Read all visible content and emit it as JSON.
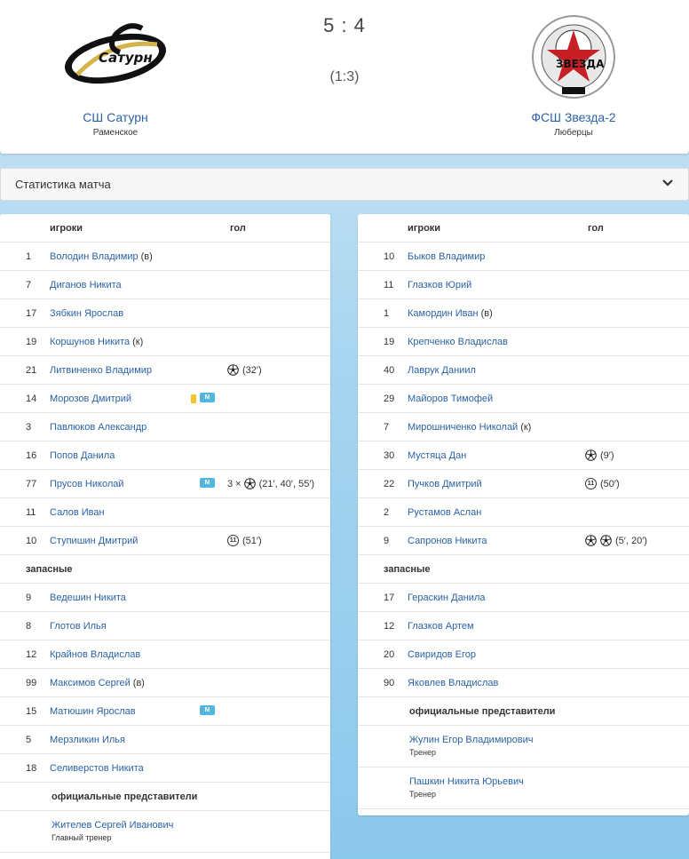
{
  "match": {
    "score": "5 : 4",
    "half_score": "(1:3)",
    "home": {
      "name": "СШ Сатурн",
      "city": "Раменское",
      "logo_text": "Сатурн"
    },
    "away": {
      "name": "ФСШ Звезда-2",
      "city": "Люберцы",
      "logo_text": "ЗВЕЗДА"
    }
  },
  "stats_bar": {
    "label": "Статистика матча"
  },
  "columns": {
    "players": "игроки",
    "goal": "гол"
  },
  "sections": {
    "subs": "запасные",
    "officials": "официальные представители"
  },
  "home_players": [
    {
      "num": "1",
      "name": "Володин Владимир",
      "tag": "(в)"
    },
    {
      "num": "7",
      "name": "Диганов Никита"
    },
    {
      "num": "17",
      "name": "Зябкин Ярослав"
    },
    {
      "num": "19",
      "name": "Коршунов Никита",
      "tag": "(к)"
    },
    {
      "num": "21",
      "name": "Литвиненко Владимир",
      "goal": "(32′)",
      "goal_type": "ball"
    },
    {
      "num": "14",
      "name": "Морозов Дмитрий",
      "yellow": true,
      "badge": "М"
    },
    {
      "num": "3",
      "name": "Павлюков Александр"
    },
    {
      "num": "16",
      "name": "Попов Данила"
    },
    {
      "num": "77",
      "name": "Прусов Николай",
      "badge": "М",
      "goal_prefix": "3 ×",
      "goal": "(21′, 40′, 55′)",
      "goal_type": "ball"
    },
    {
      "num": "11",
      "name": "Салов Иван"
    },
    {
      "num": "10",
      "name": "Ступишин Дмитрий",
      "goal": "(51′)",
      "goal_type": "pen"
    }
  ],
  "home_subs": [
    {
      "num": "9",
      "name": "Ведешин Никита"
    },
    {
      "num": "8",
      "name": "Глотов Илья"
    },
    {
      "num": "12",
      "name": "Крайнов Владислав"
    },
    {
      "num": "99",
      "name": "Максимов Сергей",
      "tag": "(в)"
    },
    {
      "num": "15",
      "name": "Матюшин Ярослав",
      "badge": "М"
    },
    {
      "num": "5",
      "name": "Мерзликин Илья"
    },
    {
      "num": "18",
      "name": "Селиверстов Никита"
    }
  ],
  "home_officials": [
    {
      "name": "Жителев Сергей Иванович",
      "role": "Главный тренер"
    }
  ],
  "away_players": [
    {
      "num": "10",
      "name": "Быков Владимир"
    },
    {
      "num": "11",
      "name": "Глазков Юрий"
    },
    {
      "num": "1",
      "name": "Камордин Иван",
      "tag": "(в)"
    },
    {
      "num": "19",
      "name": "Крепченко Владислав"
    },
    {
      "num": "40",
      "name": "Лаврук Даниил"
    },
    {
      "num": "29",
      "name": "Майоров Тимофей"
    },
    {
      "num": "7",
      "name": "Мирошниченко Николай",
      "tag": "(к)"
    },
    {
      "num": "30",
      "name": "Мустяца Дан",
      "goal": "(9′)",
      "goal_type": "ball"
    },
    {
      "num": "22",
      "name": "Пучков Дмитрий",
      "goal": "(50′)",
      "goal_type": "pen"
    },
    {
      "num": "2",
      "name": "Рустамов Аслан"
    },
    {
      "num": "9",
      "name": "Сапронов Никита",
      "goal": "(5′, 20′)",
      "goal_type": "ball2"
    }
  ],
  "away_subs": [
    {
      "num": "17",
      "name": "Гераскин Данила"
    },
    {
      "num": "12",
      "name": "Глазков Артем"
    },
    {
      "num": "20",
      "name": "Свиридов Егор"
    },
    {
      "num": "90",
      "name": "Яковлев Владислав"
    }
  ],
  "away_officials": [
    {
      "name": "Жулин Егор Владимирович",
      "role": "Тренер"
    },
    {
      "name": "Пашкин Никита Юрьевич",
      "role": "Тренер"
    }
  ],
  "icons": {
    "ball": "soccer-ball-icon",
    "pen": "penalty-icon",
    "chevron": "chevron-down-icon"
  },
  "colors": {
    "link": "#2a62a6",
    "badge": "#4fb7e0",
    "yellow_card": "#f0c531"
  }
}
